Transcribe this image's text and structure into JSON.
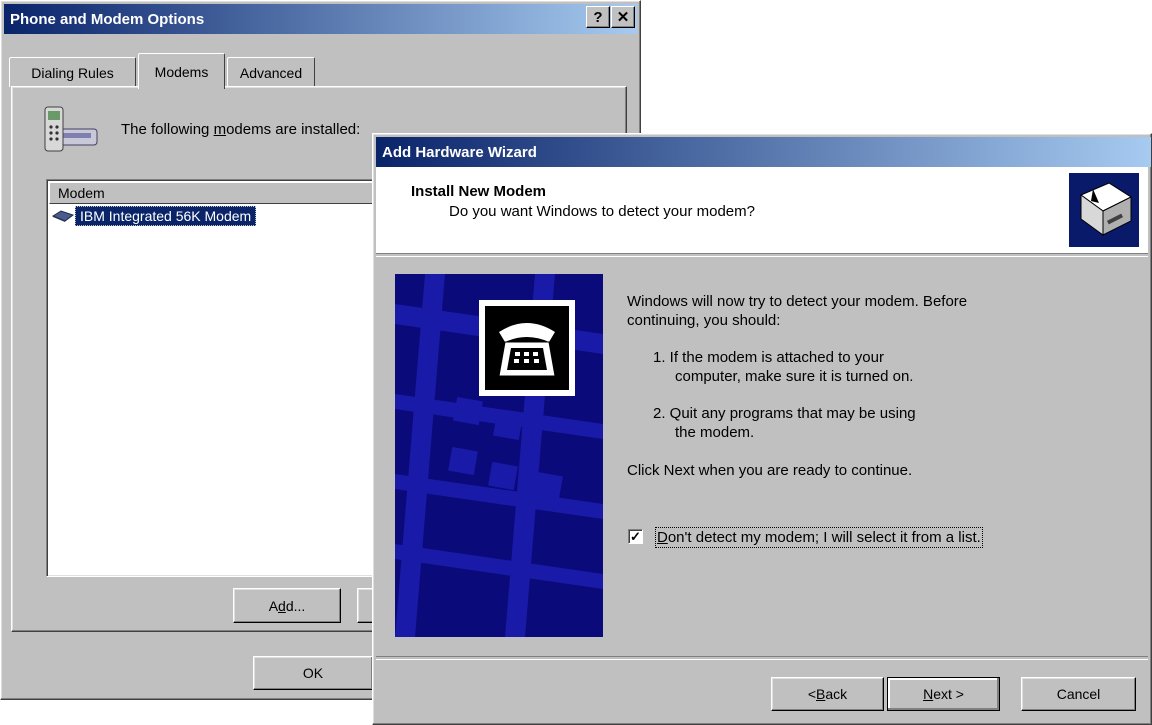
{
  "phone_modem_options": {
    "title": "Phone and Modem Options",
    "help_glyph": "?",
    "close_glyph": "✕",
    "tabs": [
      {
        "label": "Dialing Rules"
      },
      {
        "label": "Modems"
      },
      {
        "label": "Advanced"
      }
    ],
    "installed_text_before": "The following ",
    "installed_text_accel": "m",
    "installed_text_after": "odems are  installed:",
    "column_header": "Modem",
    "modems": [
      {
        "name": "IBM Integrated 56K Modem"
      }
    ],
    "add_button": {
      "before": "A",
      "accel": "d",
      "after": "d..."
    },
    "ok_button": "OK"
  },
  "wizard": {
    "title": "Add Hardware Wizard",
    "heading": "Install New Modem",
    "subheading": "Do you want Windows to detect your modem?",
    "intro_line1": "Windows will now try to detect your modem.  Before",
    "intro_line2": "continuing, you should:",
    "step1_line1": "1.  If the modem is attached to your",
    "step1_line2": "computer, make sure it is turned on.",
    "step2_line1": "2.  Quit any programs that may be using",
    "step2_line2": "the modem.",
    "click_next": "Click Next when you are ready to continue.",
    "checkbox": {
      "checked": true,
      "accel": "D",
      "label_rest": "on't detect my modem; I will select it from a list."
    },
    "back_button": {
      "prefix": "< ",
      "accel": "B",
      "rest": "ack"
    },
    "next_button": {
      "accel": "N",
      "rest": "ext >"
    },
    "cancel_button": "Cancel"
  },
  "colors": {
    "title_start": "#0a246a",
    "title_end": "#a6caf0",
    "face": "#c0c0c0",
    "banner": "#0a0a7a"
  },
  "icons": [
    "phone-modem-icon",
    "modem-device-icon",
    "wizard-hardware-icon",
    "telephone-icon",
    "help-icon",
    "close-icon",
    "checkmark-icon"
  ]
}
